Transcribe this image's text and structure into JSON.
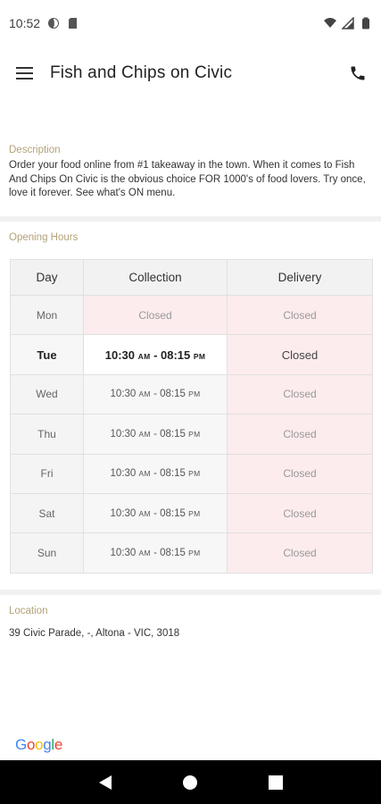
{
  "status_bar": {
    "time": "10:52"
  },
  "app_bar": {
    "title": "Fish and Chips on Civic"
  },
  "description": {
    "label": "Description",
    "text": "Order your food online from #1 takeaway in the town. When it comes to Fish And Chips On Civic is the obvious choice FOR 1000's of food lovers. Try once, love it forever. See what's ON menu."
  },
  "opening_hours": {
    "label": "Opening Hours",
    "headers": [
      "Day",
      "Collection",
      "Delivery"
    ],
    "rows": [
      {
        "day": "Mon",
        "collection": "Closed",
        "delivery": "Closed"
      },
      {
        "day": "Tue",
        "collection_open": "10:30",
        "collection_open_ampm": "AM",
        "collection_close": "08:15",
        "collection_close_ampm": "PM",
        "delivery": "Closed"
      },
      {
        "day": "Wed",
        "collection_open": "10:30",
        "collection_open_ampm": "AM",
        "collection_close": "08:15",
        "collection_close_ampm": "PM",
        "delivery": "Closed"
      },
      {
        "day": "Thu",
        "collection_open": "10:30",
        "collection_open_ampm": "AM",
        "collection_close": "08:15",
        "collection_close_ampm": "PM",
        "delivery": "Closed"
      },
      {
        "day": "Fri",
        "collection_open": "10:30",
        "collection_open_ampm": "AM",
        "collection_close": "08:15",
        "collection_close_ampm": "PM",
        "delivery": "Closed"
      },
      {
        "day": "Sat",
        "collection_open": "10:30",
        "collection_open_ampm": "AM",
        "collection_close": "08:15",
        "collection_close_ampm": "PM",
        "delivery": "Closed"
      },
      {
        "day": "Sun",
        "collection_open": "10:30",
        "collection_open_ampm": "AM",
        "collection_close": "08:15",
        "collection_close_ampm": "PM",
        "delivery": "Closed"
      }
    ]
  },
  "location": {
    "label": "Location",
    "address": "39 Civic Parade, -, Altona - VIC, 3018"
  },
  "google_logo": {
    "letters": [
      "G",
      "o",
      "o",
      "g",
      "l",
      "e"
    ],
    "colors": [
      "#4285F4",
      "#EA4335",
      "#FBBC05",
      "#4285F4",
      "#34A853",
      "#EA4335"
    ]
  },
  "icons": {
    "status_left": [
      "data-saver-icon",
      "sd-card-icon"
    ],
    "status_right": [
      "wifi-icon",
      "signal-icon",
      "battery-icon"
    ],
    "app_bar": [
      "menu-icon",
      "phone-icon"
    ],
    "nav_bar": [
      "back-icon",
      "home-icon",
      "recents-icon"
    ]
  }
}
